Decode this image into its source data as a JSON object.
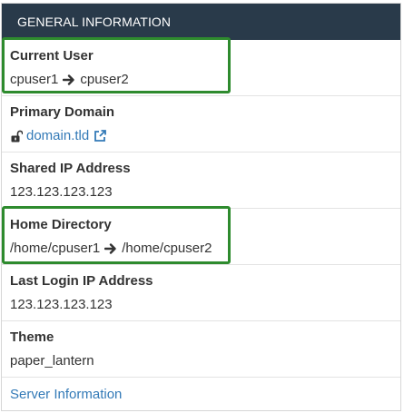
{
  "panel": {
    "title": "GENERAL INFORMATION"
  },
  "current_user": {
    "label": "Current User",
    "from": "cpuser1",
    "to": "cpuser2"
  },
  "primary_domain": {
    "label": "Primary Domain",
    "value": "domain.tld"
  },
  "shared_ip": {
    "label": "Shared IP Address",
    "value": "123.123.123.123"
  },
  "home_directory": {
    "label": "Home Directory",
    "from": "/home/cpuser1",
    "to": "/home/cpuser2"
  },
  "last_login_ip": {
    "label": "Last Login IP Address",
    "value": "123.123.123.123"
  },
  "theme": {
    "label": "Theme",
    "value": "paper_lantern"
  },
  "footer": {
    "link": "Server Information"
  },
  "colors": {
    "header_bg": "#293a4a",
    "highlight": "#2e8b2e",
    "link": "#337ab7"
  },
  "icons": [
    "arrow-right-icon",
    "lock-open-icon",
    "external-link-icon"
  ]
}
